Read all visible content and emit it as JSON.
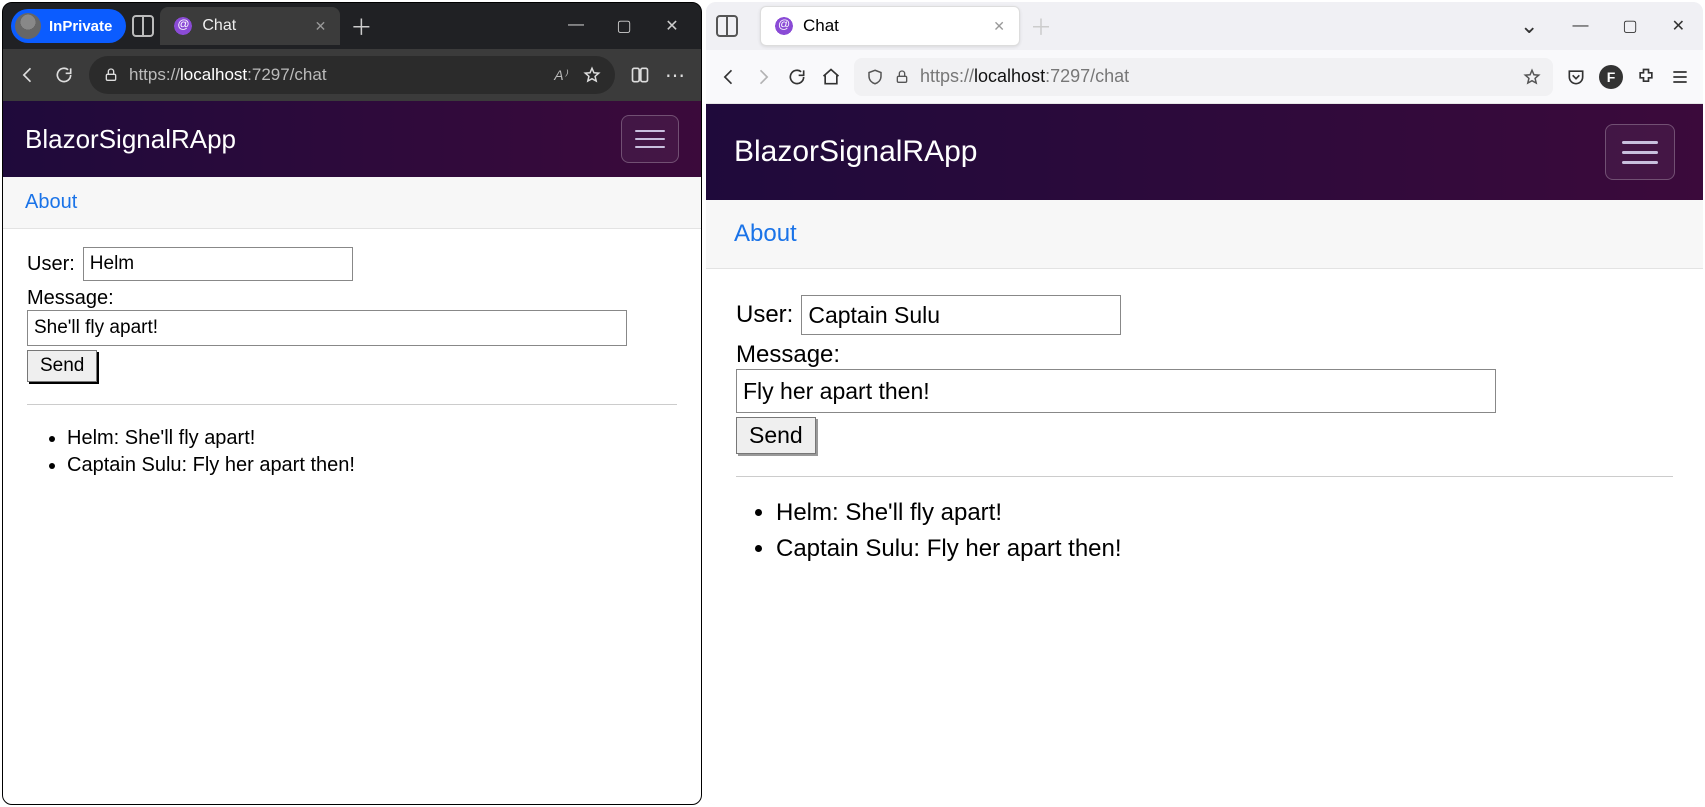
{
  "edge": {
    "inprivate_label": "InPrivate",
    "tab_title": "Chat",
    "url_prefix": "https://",
    "url_host": "localhost",
    "url_suffix": ":7297/chat"
  },
  "firefox": {
    "tab_title": "Chat",
    "tab_list_glyph": "⌄",
    "url_prefix": "https://",
    "url_host": "localhost",
    "url_suffix": ":7297/chat",
    "profile_letter": "F"
  },
  "app": {
    "title": "BlazorSignalRApp",
    "about_label": "About",
    "user_label": "User:",
    "message_label": "Message:",
    "send_label": "Send"
  },
  "left_pane": {
    "user_value": "Helm",
    "message_value": "She'll fly apart!",
    "messages": [
      "Helm: She'll fly apart!",
      "Captain Sulu: Fly her apart then!"
    ]
  },
  "right_pane": {
    "user_value": "Captain Sulu",
    "message_value": "Fly her apart then!",
    "messages": [
      "Helm: She'll fly apart!",
      "Captain Sulu: Fly her apart then!"
    ]
  }
}
